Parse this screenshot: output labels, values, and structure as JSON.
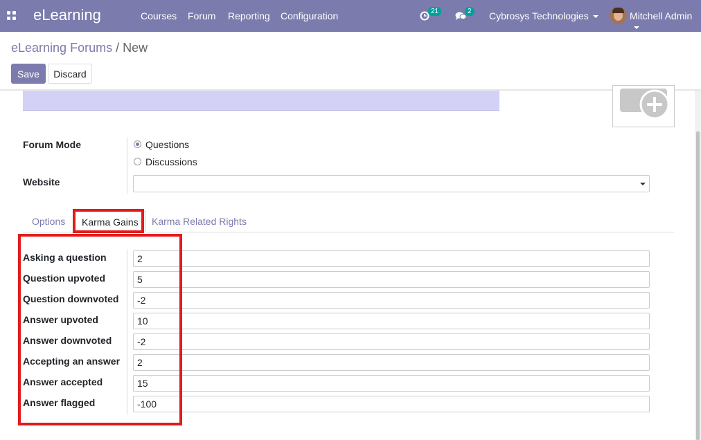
{
  "navbar": {
    "app_name": "eLearning",
    "menu": [
      "Courses",
      "Forum",
      "Reporting",
      "Configuration"
    ],
    "activity_count": "21",
    "message_count": "2",
    "company": "Cybrosys Technologies",
    "user": "Mitchell Admin",
    "bg_color": "#7c7bad"
  },
  "breadcrumb": {
    "parent": "eLearning Forums",
    "separator": "/",
    "current": "New"
  },
  "buttons": {
    "save": "Save",
    "discard": "Discard"
  },
  "form": {
    "forum_mode_label": "Forum Mode",
    "forum_mode_options": [
      "Questions",
      "Discussions"
    ],
    "forum_mode_selected": "Questions",
    "website_label": "Website",
    "website_value": ""
  },
  "tabs": [
    "Options",
    "Karma Gains",
    "Karma Related Rights"
  ],
  "active_tab": "Karma Gains",
  "karma_gains": [
    {
      "label": "Asking a question",
      "value": "2"
    },
    {
      "label": "Question upvoted",
      "value": "5"
    },
    {
      "label": "Question downvoted",
      "value": "-2"
    },
    {
      "label": "Answer upvoted",
      "value": "10"
    },
    {
      "label": "Answer downvoted",
      "value": "-2"
    },
    {
      "label": "Accepting an answer",
      "value": "2"
    },
    {
      "label": "Answer accepted",
      "value": "15"
    },
    {
      "label": "Answer flagged",
      "value": "-100"
    }
  ],
  "highlight_color": "#e21b1b"
}
